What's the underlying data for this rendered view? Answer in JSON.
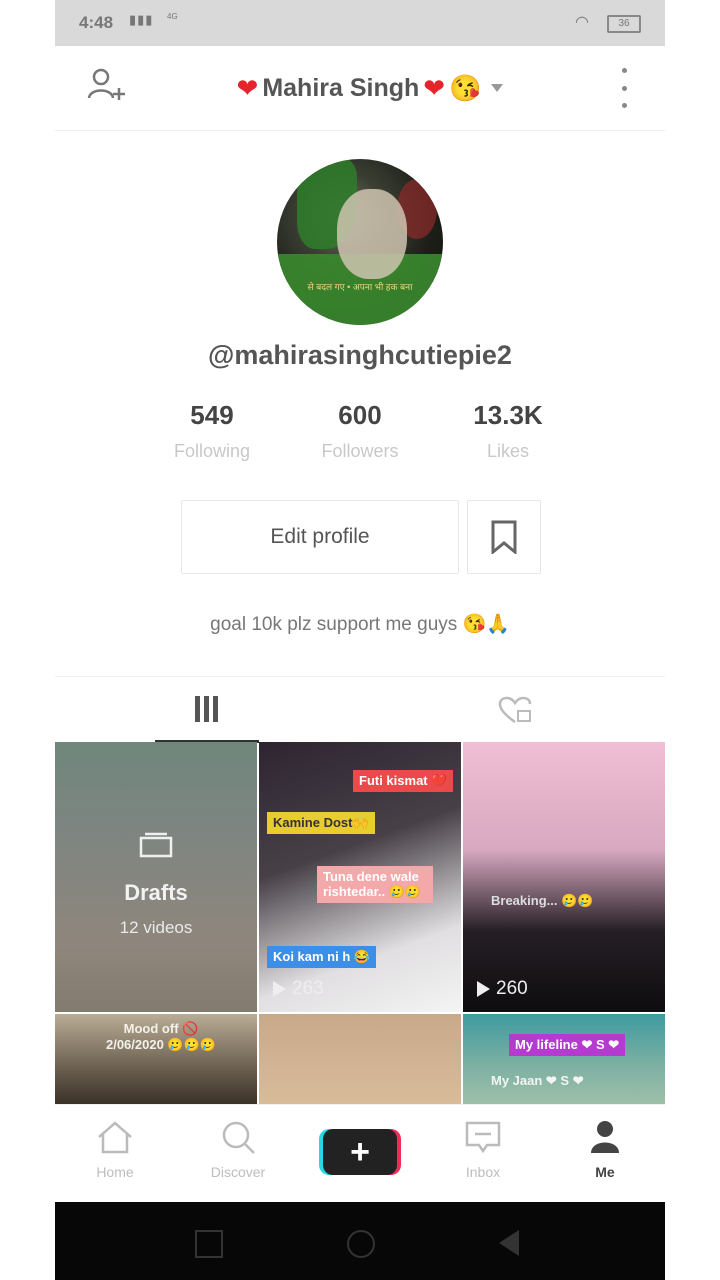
{
  "status": {
    "time": "4:48",
    "signal": "ᴬᴬᴵᴵ",
    "net": "4G",
    "battery": "36"
  },
  "header": {
    "name": "Mahira Singh"
  },
  "profile": {
    "username": "@mahirasinghcutiepie2",
    "avatar_caption": "से बदल गए • अपना भी हक बना",
    "bio": "goal 10k plz support me guys 😘🙏"
  },
  "stats": [
    {
      "value": "549",
      "label": "Following"
    },
    {
      "value": "600",
      "label": "Followers"
    },
    {
      "value": "13.3K",
      "label": "Likes"
    }
  ],
  "buttons": {
    "edit_profile": "Edit profile"
  },
  "grid": {
    "drafts": {
      "label": "Drafts",
      "count": "12 videos"
    },
    "video2": {
      "tags": [
        "Futi kismat 💔",
        "Kamine Dost🙌",
        "Tuna dene wale rishtedar.. 🥲🥲",
        "Koi kam ni h 😂"
      ],
      "plays": "263"
    },
    "video3": {
      "tag": "Breaking... 🥲🥲",
      "plays": "260"
    },
    "video4": {
      "text": "Mood off 🚫 2/06/2020 🥲🥲🥲"
    },
    "video6": {
      "tag": "My lifeline ❤ S ❤",
      "text": "My Jaan ❤ S ❤"
    }
  },
  "nav": {
    "home": "Home",
    "discover": "Discover",
    "inbox": "Inbox",
    "me": "Me"
  },
  "colors": {
    "heart": "#e6242b",
    "create_cyan": "#25d8e6",
    "create_pink": "#ee2c57"
  }
}
